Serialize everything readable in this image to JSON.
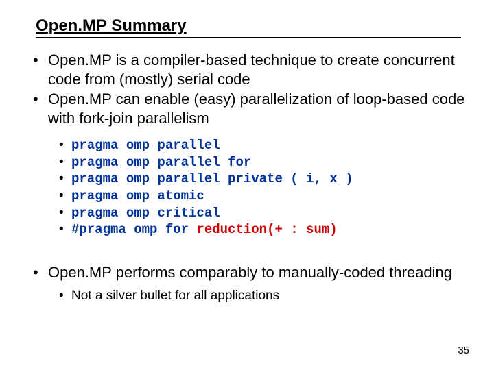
{
  "title": "Open.MP Summary",
  "bullets": {
    "b1": "Open.MP is a compiler-based technique to create concurrent code from (mostly) serial code",
    "b2": "Open.MP can enable (easy) parallelization of loop-based code with fork-join parallelism",
    "b3": "Open.MP performs comparably to manually-coded threading"
  },
  "pragmas": {
    "p1": "pragma omp parallel",
    "p2": "pragma omp parallel for",
    "p3": "pragma omp parallel private ( i, x )",
    "p4": "pragma omp atomic",
    "p5": "pragma omp critical",
    "p6_prefix": "#pragma omp for ",
    "p6_highlight": "reduction(+ : sum)"
  },
  "sub2": {
    "s1": "Not a silver bullet for all applications"
  },
  "page_number": "35"
}
